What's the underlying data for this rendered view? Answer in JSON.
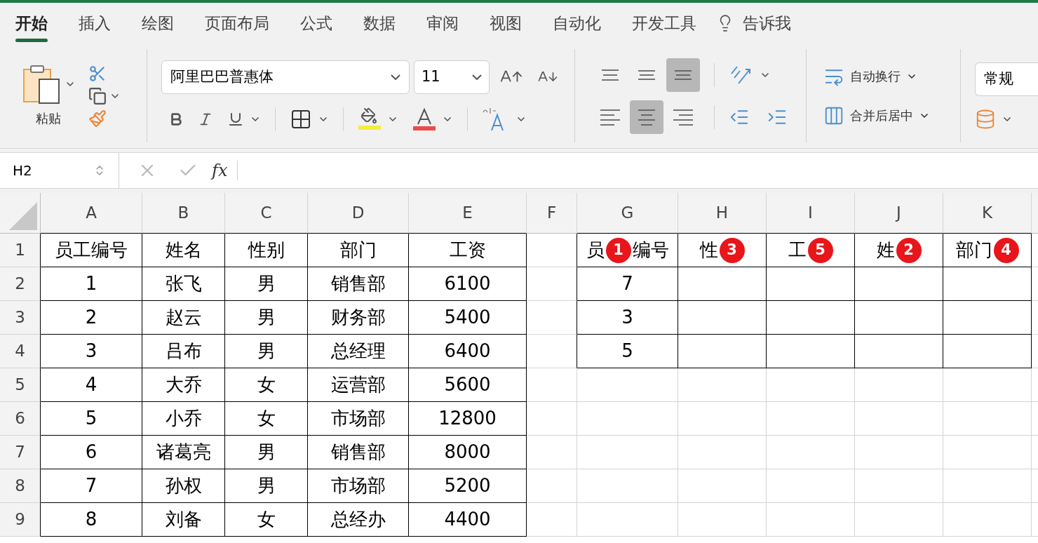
{
  "tabs": [
    {
      "label": "开始",
      "selected": true
    },
    {
      "label": "插入",
      "selected": false
    },
    {
      "label": "绘图",
      "selected": false
    },
    {
      "label": "页面布局",
      "selected": false
    },
    {
      "label": "公式",
      "selected": false
    },
    {
      "label": "数据",
      "selected": false
    },
    {
      "label": "审阅",
      "selected": false
    },
    {
      "label": "视图",
      "selected": false
    },
    {
      "label": "自动化",
      "selected": false
    },
    {
      "label": "开发工具",
      "selected": false
    }
  ],
  "tell_me": "告诉我",
  "ribbon": {
    "paste_label": "粘贴",
    "font_name": "阿里巴巴普惠体",
    "font_size": "11",
    "vertical_align": [
      {
        "kind": "top",
        "selected": false
      },
      {
        "kind": "middle",
        "selected": false
      },
      {
        "kind": "bottom",
        "selected": true
      }
    ],
    "horizontal_align": [
      {
        "kind": "left",
        "selected": false
      },
      {
        "kind": "center",
        "selected": true
      },
      {
        "kind": "right",
        "selected": false
      }
    ],
    "wrap_text": "自动换行",
    "merge_center": "合并后居中",
    "number_format": "常规"
  },
  "formula_bar": {
    "name_box": "H2",
    "fx": "fx"
  },
  "sheet": {
    "columns": [
      "A",
      "B",
      "C",
      "D",
      "E",
      "F",
      "G",
      "H",
      "I",
      "J",
      "K"
    ],
    "rows": [
      {
        "number": "1",
        "cells": [
          {
            "text": "员工编号",
            "bordered": true
          },
          {
            "text": "姓名",
            "bordered": true
          },
          {
            "text": "性别",
            "bordered": true
          },
          {
            "text": "部门",
            "bordered": true
          },
          {
            "text": "工资",
            "bordered": true
          },
          {
            "bordered": false
          },
          {
            "text": "员",
            "bordered": true,
            "badge": "1",
            "text_after": "编号"
          },
          {
            "text": "性",
            "bordered": true,
            "badge": "3"
          },
          {
            "text": "工",
            "bordered": true,
            "badge": "5"
          },
          {
            "text": "姓",
            "bordered": true,
            "badge": "2"
          },
          {
            "text": "部门",
            "bordered": true,
            "badge": "4"
          }
        ]
      },
      {
        "number": "2",
        "cells": [
          {
            "text": "1",
            "bordered": true
          },
          {
            "text": "张飞",
            "bordered": true
          },
          {
            "text": "男",
            "bordered": true
          },
          {
            "text": "销售部",
            "bordered": true
          },
          {
            "text": "6100",
            "bordered": true
          },
          {
            "bordered": false
          },
          {
            "text": "7",
            "bordered": true
          },
          {
            "bordered": true
          },
          {
            "bordered": true
          },
          {
            "bordered": true
          },
          {
            "bordered": true
          }
        ]
      },
      {
        "number": "3",
        "cells": [
          {
            "text": "2",
            "bordered": true
          },
          {
            "text": "赵云",
            "bordered": true
          },
          {
            "text": "男",
            "bordered": true
          },
          {
            "text": "财务部",
            "bordered": true
          },
          {
            "text": "5400",
            "bordered": true
          },
          {
            "bordered": false
          },
          {
            "text": "3",
            "bordered": true
          },
          {
            "bordered": true
          },
          {
            "bordered": true
          },
          {
            "bordered": true
          },
          {
            "bordered": true
          }
        ]
      },
      {
        "number": "4",
        "cells": [
          {
            "text": "3",
            "bordered": true
          },
          {
            "text": "吕布",
            "bordered": true
          },
          {
            "text": "男",
            "bordered": true
          },
          {
            "text": "总经理",
            "bordered": true
          },
          {
            "text": "6400",
            "bordered": true
          },
          {
            "bordered": false
          },
          {
            "text": "5",
            "bordered": true
          },
          {
            "bordered": true
          },
          {
            "bordered": true
          },
          {
            "bordered": true
          },
          {
            "bordered": true
          }
        ]
      },
      {
        "number": "5",
        "cells": [
          {
            "text": "4",
            "bordered": true
          },
          {
            "text": "大乔",
            "bordered": true
          },
          {
            "text": "女",
            "bordered": true
          },
          {
            "text": "运营部",
            "bordered": true
          },
          {
            "text": "5600",
            "bordered": true
          },
          {
            "bordered": false
          },
          {
            "bordered": false
          },
          {
            "bordered": false
          },
          {
            "bordered": false
          },
          {
            "bordered": false
          },
          {
            "bordered": false
          }
        ]
      },
      {
        "number": "6",
        "cells": [
          {
            "text": "5",
            "bordered": true
          },
          {
            "text": "小乔",
            "bordered": true
          },
          {
            "text": "女",
            "bordered": true
          },
          {
            "text": "市场部",
            "bordered": true
          },
          {
            "text": "12800",
            "bordered": true
          },
          {
            "bordered": false
          },
          {
            "bordered": false
          },
          {
            "bordered": false
          },
          {
            "bordered": false
          },
          {
            "bordered": false
          },
          {
            "bordered": false
          }
        ]
      },
      {
        "number": "7",
        "cells": [
          {
            "text": "6",
            "bordered": true
          },
          {
            "text": "诸葛亮",
            "bordered": true
          },
          {
            "text": "男",
            "bordered": true
          },
          {
            "text": "销售部",
            "bordered": true
          },
          {
            "text": "8000",
            "bordered": true
          },
          {
            "bordered": false
          },
          {
            "bordered": false
          },
          {
            "bordered": false
          },
          {
            "bordered": false
          },
          {
            "bordered": false
          },
          {
            "bordered": false
          }
        ]
      },
      {
        "number": "8",
        "cells": [
          {
            "text": "7",
            "bordered": true
          },
          {
            "text": "孙权",
            "bordered": true
          },
          {
            "text": "男",
            "bordered": true
          },
          {
            "text": "市场部",
            "bordered": true
          },
          {
            "text": "5200",
            "bordered": true
          },
          {
            "bordered": false
          },
          {
            "bordered": false
          },
          {
            "bordered": false
          },
          {
            "bordered": false
          },
          {
            "bordered": false
          },
          {
            "bordered": false
          }
        ]
      },
      {
        "number": "9",
        "cells": [
          {
            "text": "8",
            "bordered": true
          },
          {
            "text": "刘备",
            "bordered": true
          },
          {
            "text": "女",
            "bordered": true
          },
          {
            "text": "总经办",
            "bordered": true
          },
          {
            "text": "4400",
            "bordered": true
          },
          {
            "bordered": false
          },
          {
            "bordered": false
          },
          {
            "bordered": false
          },
          {
            "bordered": false
          },
          {
            "bordered": false
          },
          {
            "bordered": false
          }
        ]
      }
    ]
  }
}
